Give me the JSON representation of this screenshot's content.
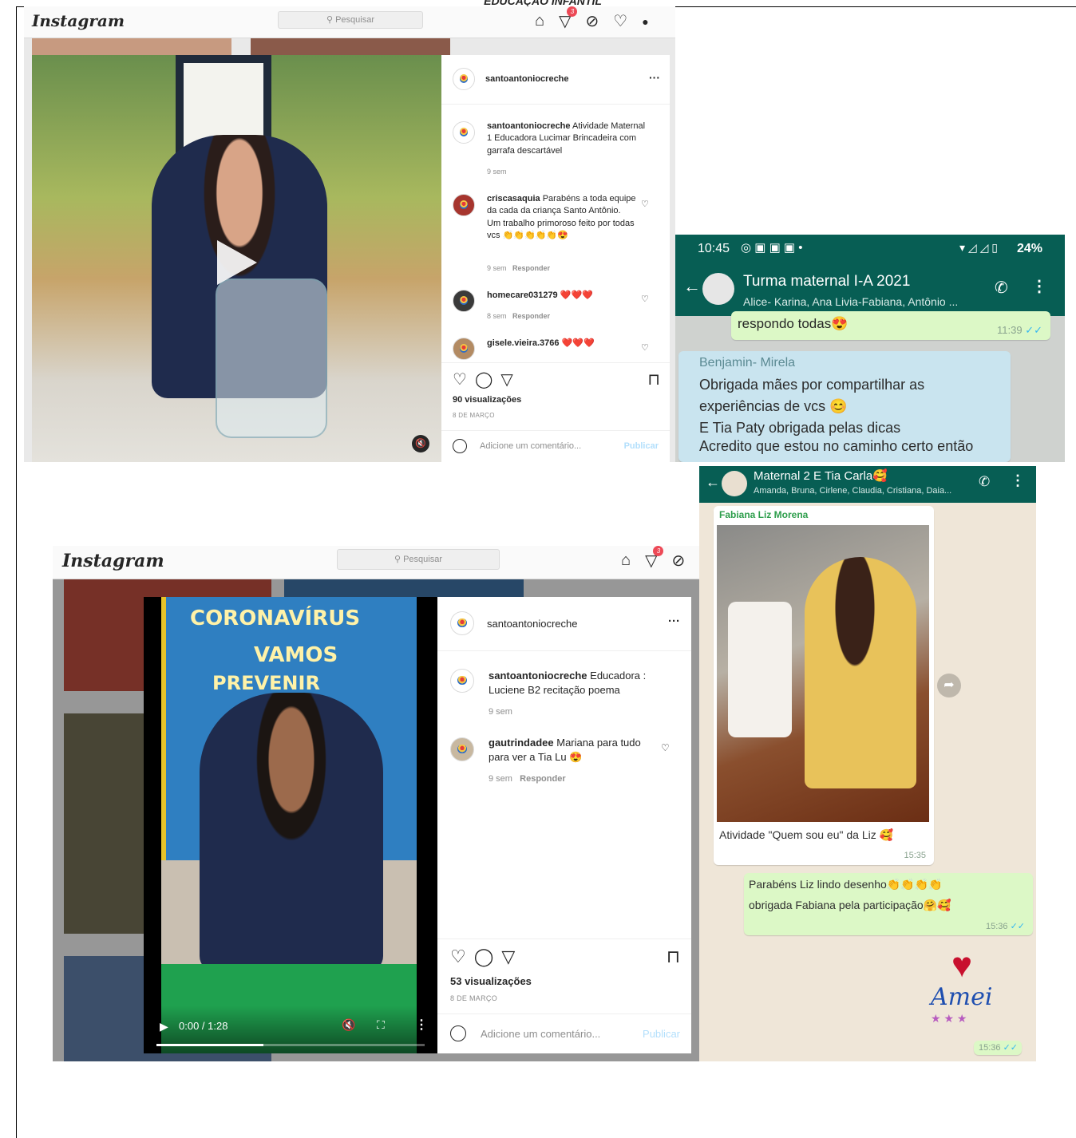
{
  "page": {
    "cut_title": "EDUCAÇÃO INFANTIL"
  },
  "ig1": {
    "logo": "Instagram",
    "search_placeholder": "Pesquisar",
    "dm_badge": "3",
    "account": "santoantoniocreche",
    "more": "···",
    "caption_user": "santoantoniocreche",
    "caption_text": " Atividade Maternal 1 Educadora Lucimar Brincadeira com garrafa descartável",
    "caption_time": "9 sem",
    "comments": [
      {
        "user": "criscasaquia",
        "text": " Parabéns a toda equipe da cada da criança Santo Antônio.",
        "text2": "Um trabalho primoroso feito por todas vcs 👏👏👏👏👏😍",
        "time": "9 sem",
        "reply": "Responder"
      },
      {
        "user": "homecare031279",
        "text": " ❤️❤️❤️",
        "time": "8 sem",
        "reply": "Responder"
      },
      {
        "user": "gisele.vieira.3766",
        "text": " ❤️❤️❤️"
      }
    ],
    "views": "90 visualizações",
    "date": "8 DE MARÇO",
    "add_comment": "Adicione um comentário...",
    "publish": "Publicar"
  },
  "ig2": {
    "logo": "Instagram",
    "search_placeholder": "Pesquisar",
    "dm_badge": "3",
    "account": "santoantoniocreche",
    "more": "···",
    "caption_user": "santoantoniocreche",
    "caption_text": " Educadora : Luciene B2 recitação poema",
    "caption_time": "9 sem",
    "comments": [
      {
        "user": "gautrindadee",
        "text": " Mariana para tudo para ver a Tia Lu 😍",
        "time": "9 sem",
        "reply": "Responder"
      }
    ],
    "views": "53 visualizações",
    "date": "8 DE MARÇO",
    "add_comment": "Adicione um comentário...",
    "publish": "Publicar",
    "video_time": "0:00 / 1:28",
    "poster_line1": "CORONAVÍRUS",
    "poster_line2": "VAMOS",
    "poster_line3": "PREVENIR",
    "progress_fraction": 0.4
  },
  "wa1": {
    "clock": "10:45",
    "battery": "24%",
    "title": "Turma maternal I-A 2021",
    "subtitle": "Alice- Karina, Ana Livia-Fabiana, Antônio ...",
    "msg1_text": "respondo todas😍",
    "msg1_time": "11:39",
    "msg2_sender": "Benjamin- Mirela",
    "msg2_lines": [
      "Obrigada mães por compartilhar as",
      "experiências de vcs 😊",
      "E Tia Paty obrigada pelas dicas",
      "Acredito que estou no caminho certo então"
    ]
  },
  "wa2": {
    "title": "Maternal 2 E Tia Carla🥰",
    "subtitle": "Amanda, Bruna, Cirlene, Claudia, Cristiana, Daia...",
    "sender": "Fabiana Liz Morena",
    "caption": "Atividade \"Quem sou eu\" da Liz 🥰",
    "caption_time": "15:35",
    "reply_line1": "Parabéns Liz lindo desenho👏👏👏👏",
    "reply_line2": "obrigada Fabiana pela participação🤗🥰",
    "reply_time": "15:36",
    "sticker_text": "Amei",
    "sticker_time": "15:36"
  },
  "colors": {
    "wa_green": "#075e54",
    "wa_out": "#dcf8c6",
    "ig_border": "#dbdbdb",
    "ig_blue_light": "#b2dffc"
  }
}
